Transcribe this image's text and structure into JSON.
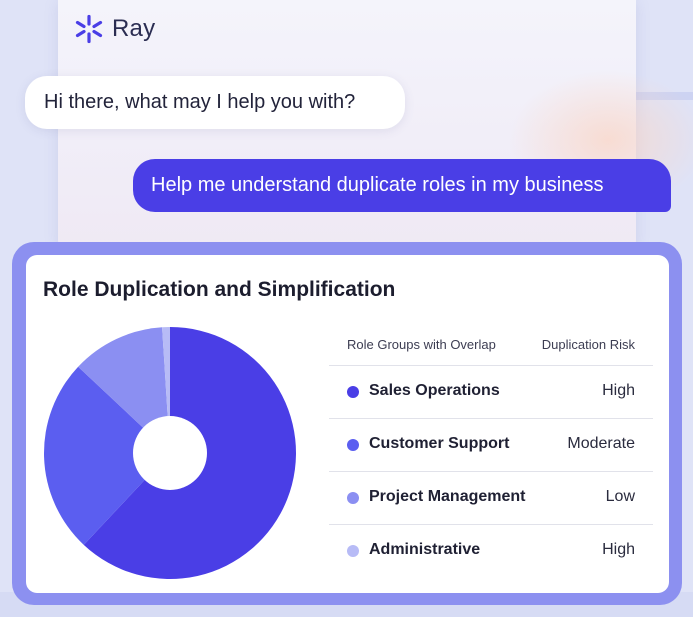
{
  "brand": {
    "name": "Ray",
    "accent": "#4a3ee6"
  },
  "chat": {
    "bot_message": "Hi there, what may I help you with?",
    "user_message": "Help me understand duplicate roles in my business"
  },
  "card": {
    "title": "Role Duplication and Simplification",
    "table": {
      "headers": [
        "Role Groups with Overlap",
        "Duplication Risk"
      ],
      "rows": [
        {
          "group": "Sales Operations",
          "risk": "High",
          "color": "#4a3ee6"
        },
        {
          "group": "Customer Support",
          "risk": "Moderate",
          "color": "#5b5ef0"
        },
        {
          "group": "Project Management",
          "risk": "Low",
          "color": "#8b8ff2"
        },
        {
          "group": "Administrative",
          "risk": "High",
          "color": "#b7bbf6"
        }
      ]
    }
  },
  "chart_data": {
    "type": "pie",
    "categories": [
      "Sales Operations",
      "Customer Support",
      "Project Management",
      "Administrative"
    ],
    "values": [
      62,
      25,
      12,
      1
    ],
    "colors": [
      "#4a3ee6",
      "#5b5ef0",
      "#8b8ff2",
      "#b7bbf6"
    ],
    "donut": true
  }
}
